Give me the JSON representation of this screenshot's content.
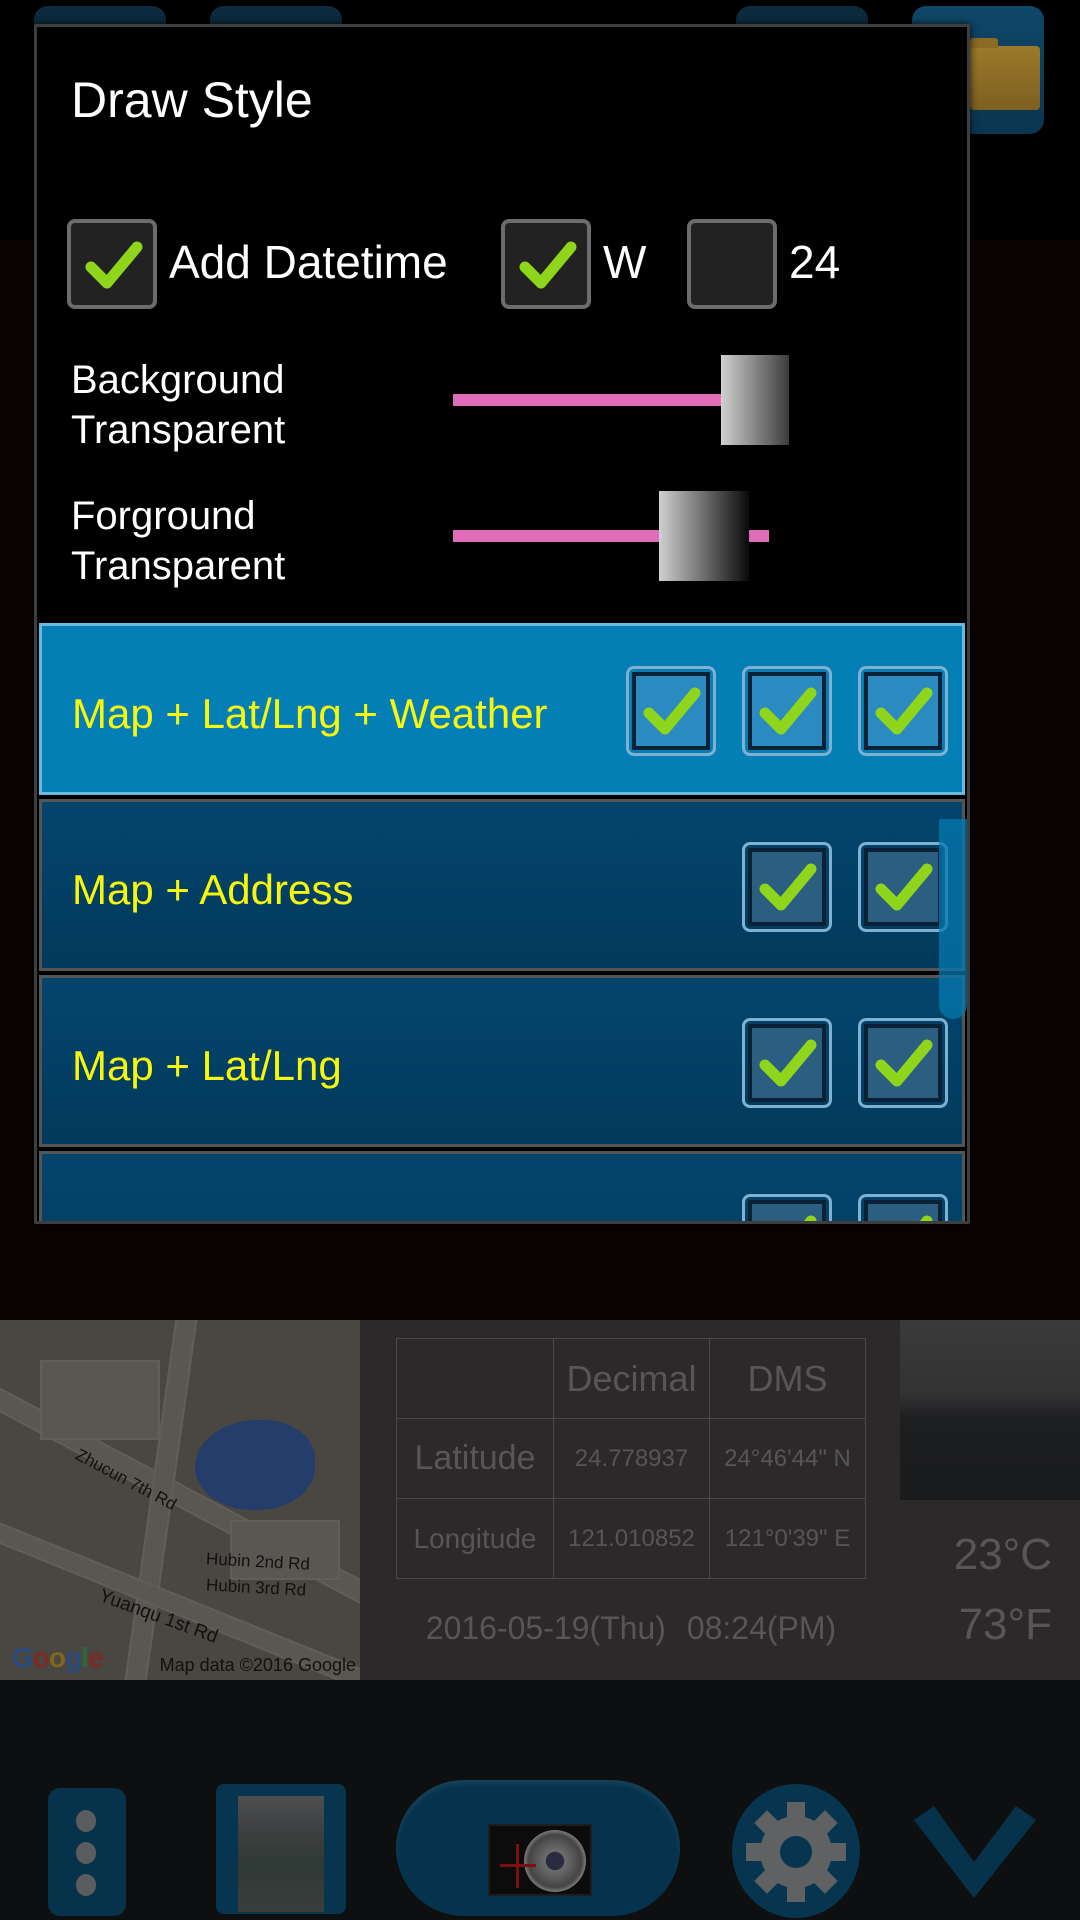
{
  "background_app": {
    "top_buttons": [
      {
        "name": "camera-switch",
        "icon": "crosshair-icon"
      },
      {
        "name": "frame",
        "icon": "frame-icon"
      },
      {
        "name": "file-format",
        "icon": "file-icon",
        "label": "???"
      },
      {
        "name": "gallery-folder",
        "icon": "folder-icon"
      }
    ],
    "map": {
      "street_labels": [
        "Zhucun 7th Rd",
        "Hubin 2nd Rd",
        "Hubin 3rd Rd",
        "Yuanqu 1st Rd"
      ],
      "logo": "Google",
      "attribution": "Map data ©2016 Google"
    },
    "coord_table": {
      "headers": [
        "",
        "Decimal",
        "DMS"
      ],
      "rows": [
        {
          "label": "Latitude",
          "decimal": "24.778937",
          "dms": "24°46'44\" N"
        },
        {
          "label": "Longitude",
          "decimal": "121.010852",
          "dms": "121°0'39\" E"
        }
      ]
    },
    "datetime": "2016-05-19(Thu)  08:24(PM)",
    "weather": {
      "celsius": "23°C",
      "fahrenheit": "73°F"
    },
    "bottom_toolbar": [
      {
        "name": "more-menu",
        "icon": "more-vertical-icon"
      },
      {
        "name": "last-photo-thumbnail",
        "icon": "photo-thumbnail-icon"
      },
      {
        "name": "shutter",
        "icon": "camera-icon"
      },
      {
        "name": "settings",
        "icon": "gear-icon"
      },
      {
        "name": "confirm",
        "icon": "checkmark-icon"
      }
    ]
  },
  "dialog": {
    "title": "Draw Style",
    "options": [
      {
        "label": "Add Datetime",
        "checked": true
      },
      {
        "label": "W",
        "checked": true
      },
      {
        "label": "24",
        "checked": false
      }
    ],
    "sliders": [
      {
        "label_line1": "Background",
        "label_line2": "Transparent",
        "value_percent": 100
      },
      {
        "label_line1": "Forground",
        "label_line2": "Transparent",
        "value_percent": 85
      }
    ],
    "styles": [
      {
        "label": "Map + Lat/Lng + Weather",
        "selected": true,
        "checks": [
          true,
          true,
          true
        ]
      },
      {
        "label": "Map + Address",
        "selected": false,
        "checks": [
          true,
          true
        ]
      },
      {
        "label": "Map + Lat/Lng",
        "selected": false,
        "checks": [
          true,
          true
        ]
      },
      {
        "label": "",
        "selected": false,
        "checks": [
          true,
          true
        ]
      }
    ]
  },
  "colors": {
    "selected_item": "#037fb5",
    "item_bg": "#013a5c",
    "item_text": "#f6f60f",
    "slider_track": "#df6cb8",
    "check": "#8ed51c"
  }
}
